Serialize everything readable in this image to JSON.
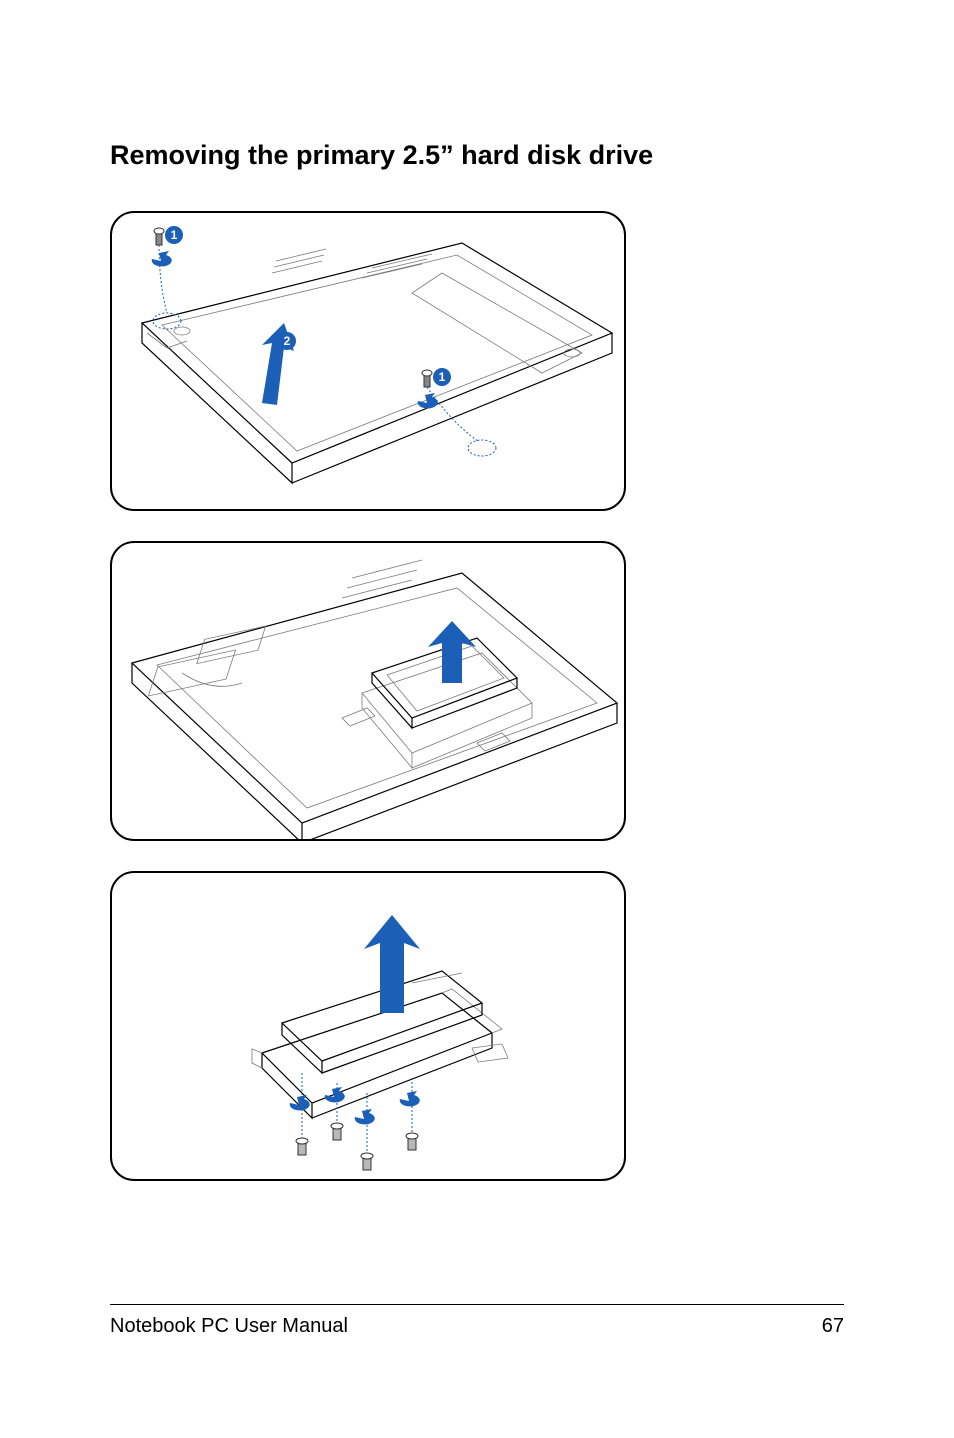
{
  "heading": "Removing the primary 2.5” hard disk drive",
  "callouts": {
    "one": "1",
    "two": "2"
  },
  "footer": {
    "manual": "Notebook PC User Manual",
    "page": "67"
  }
}
